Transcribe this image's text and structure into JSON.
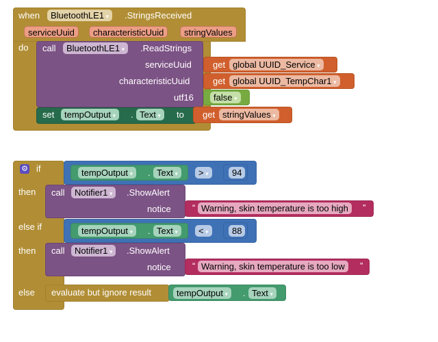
{
  "event_block": {
    "when_label": "when",
    "component": "BluetoothLE1",
    "event": ".StringsReceived",
    "params": [
      "serviceUuid",
      "characteristicUuid",
      "stringValues"
    ],
    "do_label": "do",
    "call": {
      "call_label": "call",
      "component": "BluetoothLE1",
      "method": ".ReadStrings",
      "args": [
        {
          "name": "serviceUuid",
          "get_label": "get",
          "value": "global UUID_Service"
        },
        {
          "name": "characteristicUuid",
          "get_label": "get",
          "value": "global UUID_TempChar1"
        },
        {
          "name": "utf16",
          "value": "false"
        }
      ]
    },
    "set": {
      "set_label": "set",
      "component": "tempOutput",
      "dot": ".",
      "property": "Text",
      "to_label": "to",
      "get_label": "get",
      "value": "stringValues"
    }
  },
  "if_block": {
    "gear_icon": "gear-icon",
    "if_label": "if",
    "then_label": "then",
    "elseif_label": "else if",
    "else_label": "else",
    "condition1": {
      "component": "tempOutput",
      "dot": ".",
      "property": "Text",
      "operator": ">",
      "number": "94"
    },
    "then1": {
      "call_label": "call",
      "component": "Notifier1",
      "method": ".ShowAlert",
      "arg_name": "notice",
      "text": "Warning, skin temperature is too high"
    },
    "condition2": {
      "component": "tempOutput",
      "dot": ".",
      "property": "Text",
      "operator": "<",
      "number": "88"
    },
    "then2": {
      "call_label": "call",
      "component": "Notifier1",
      "method": ".ShowAlert",
      "arg_name": "notice",
      "text": "Warning, skin temperature is too low"
    },
    "else_stmt": {
      "label": "evaluate but ignore result",
      "component": "tempOutput",
      "dot": ".",
      "property": "Text"
    }
  },
  "quote_glyph": "“",
  "quote_glyph_close": "”"
}
